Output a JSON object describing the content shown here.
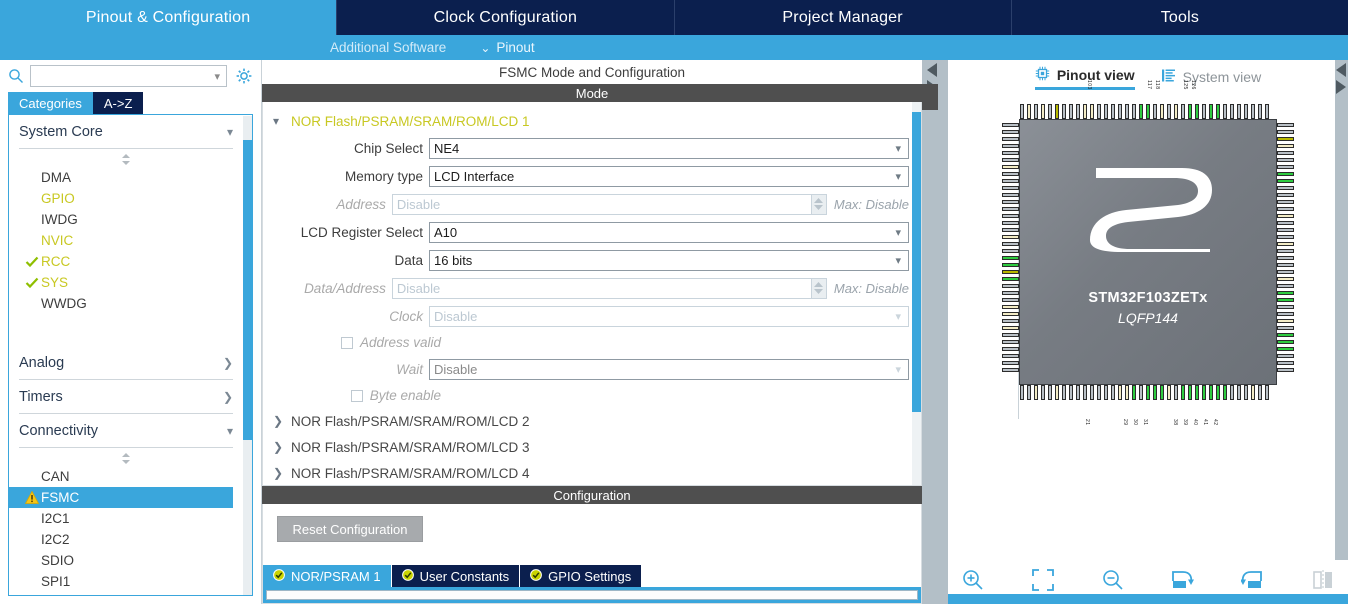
{
  "topbar": {
    "tabs": [
      {
        "label": "Pinout & Configuration",
        "active": true
      },
      {
        "label": "Clock Configuration",
        "active": false
      },
      {
        "label": "Project Manager",
        "active": false
      },
      {
        "label": "Tools",
        "active": false
      }
    ]
  },
  "subbar": {
    "additional_software": "Additional Software",
    "pinout": "Pinout",
    "pinout_chevron": "⌄"
  },
  "left_panel": {
    "search": {
      "value": "",
      "placeholder": "",
      "icon": "search-icon"
    },
    "gear_icon": "gear-icon",
    "category_tabs": [
      {
        "label": "Categories",
        "selected": true
      },
      {
        "label": "A->Z",
        "selected": false
      }
    ],
    "groups": [
      {
        "title": "System Core",
        "expanded": true,
        "items": [
          {
            "label": "DMA",
            "state": "none"
          },
          {
            "label": "GPIO",
            "state": "configured"
          },
          {
            "label": "IWDG",
            "state": "none"
          },
          {
            "label": "NVIC",
            "state": "configured"
          },
          {
            "label": "RCC",
            "state": "checked"
          },
          {
            "label": "SYS",
            "state": "checked"
          },
          {
            "label": "WWDG",
            "state": "none"
          }
        ]
      },
      {
        "title": "Analog",
        "expanded": false,
        "items": []
      },
      {
        "title": "Timers",
        "expanded": false,
        "items": []
      },
      {
        "title": "Connectivity",
        "expanded": true,
        "items": [
          {
            "label": "CAN",
            "state": "none"
          },
          {
            "label": "FSMC",
            "state": "warning",
            "selected": true
          },
          {
            "label": "I2C1",
            "state": "none"
          },
          {
            "label": "I2C2",
            "state": "none"
          },
          {
            "label": "SDIO",
            "state": "none"
          },
          {
            "label": "SPI1",
            "state": "none"
          }
        ]
      }
    ]
  },
  "middle_panel": {
    "title": "FSMC Mode and Configuration",
    "mode_band": "Mode",
    "config_band": "Configuration",
    "sections": [
      {
        "label": "NOR Flash/PSRAM/SRAM/ROM/LCD 1",
        "expanded": true,
        "active": true
      },
      {
        "label": "NOR Flash/PSRAM/SRAM/ROM/LCD 2",
        "expanded": false,
        "active": false
      },
      {
        "label": "NOR Flash/PSRAM/SRAM/ROM/LCD 3",
        "expanded": false,
        "active": false
      },
      {
        "label": "NOR Flash/PSRAM/SRAM/ROM/LCD 4",
        "expanded": false,
        "active": false
      }
    ],
    "fields": [
      {
        "label": "Chip Select",
        "value": "NE4",
        "type": "select",
        "disabled": false
      },
      {
        "label": "Memory type",
        "value": "LCD Interface",
        "type": "select",
        "disabled": false
      },
      {
        "label": "Address",
        "value": "Disable",
        "type": "spinner",
        "disabled": true,
        "note": "Max: Disable"
      },
      {
        "label": "LCD Register Select",
        "value": "A10",
        "type": "select",
        "disabled": false
      },
      {
        "label": "Data",
        "value": "16 bits",
        "type": "select",
        "disabled": false
      },
      {
        "label": "Data/Address",
        "value": "Disable",
        "type": "spinner",
        "disabled": true,
        "note": "Max: Disable"
      },
      {
        "label": "Clock",
        "value": "Disable",
        "type": "select",
        "disabled": true
      },
      {
        "label": "Address valid",
        "value": "",
        "type": "checkbox",
        "disabled": true,
        "checked": false
      },
      {
        "label": "Wait",
        "value": "Disable",
        "type": "select",
        "disabled": true
      },
      {
        "label": "Byte enable",
        "value": "",
        "type": "checkbox",
        "disabled": true,
        "checked": false
      }
    ],
    "reset_button": "Reset Configuration",
    "config_tabs": [
      {
        "label": "NOR/PSRAM 1",
        "active": true,
        "icon": "check-circle-icon"
      },
      {
        "label": "User Constants",
        "active": false,
        "icon": "check-circle-icon"
      },
      {
        "label": "GPIO Settings",
        "active": false,
        "icon": "check-circle-icon"
      }
    ]
  },
  "right_panel": {
    "view_tabs": [
      {
        "label": "Pinout view",
        "active": true,
        "icon": "chip-icon"
      },
      {
        "label": "System view",
        "active": false,
        "icon": "list-icon"
      }
    ],
    "chip": {
      "name": "STM32F103ZETx",
      "package": "LQFP144",
      "logo": "st-logo"
    },
    "toolbar": [
      {
        "icon": "zoom-in-icon",
        "name": "zoom-in-button"
      },
      {
        "icon": "fit-screen-icon",
        "name": "fit-screen-button"
      },
      {
        "icon": "zoom-out-icon",
        "name": "zoom-out-button"
      },
      {
        "icon": "rotate-right-icon",
        "name": "rotate-right-button"
      },
      {
        "icon": "rotate-left-icon",
        "name": "rotate-left-button"
      },
      {
        "icon": "flip-icon",
        "name": "flip-button"
      }
    ]
  },
  "colors": {
    "accent_blue": "#3aa6dc",
    "navy": "#0b1f4e",
    "band_gray": "#4f4f4f",
    "configured_yellow": "#c8c822",
    "warning_amber": "#f5c518",
    "check_green": "#8fbf00"
  }
}
